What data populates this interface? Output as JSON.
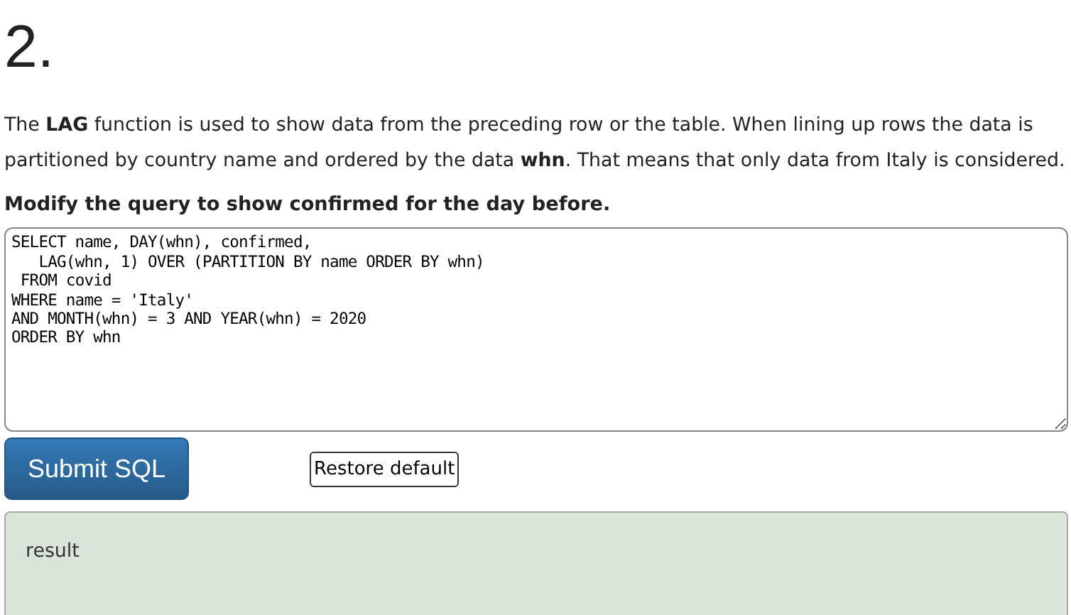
{
  "heading": "2.",
  "description": "The **LAG** function is used to show data from the preceding row or the table. When lining up rows the data is partitioned by country name and ordered by the data **whn**. That means that only data from Italy is considered.",
  "task": "Modify the query to show confirmed for the day before.",
  "query": "SELECT name, DAY(whn), confirmed,\n   LAG(whn, 1) OVER (PARTITION BY name ORDER BY whn)\n FROM covid\nWHERE name = 'Italy'\nAND MONTH(whn) = 3 AND YEAR(whn) = 2020\nORDER BY whn",
  "buttons": [
    {
      "label": "Submit SQL",
      "kind": "primary"
    },
    {
      "label": "Restore default",
      "kind": "plain"
    }
  ],
  "result": "result"
}
